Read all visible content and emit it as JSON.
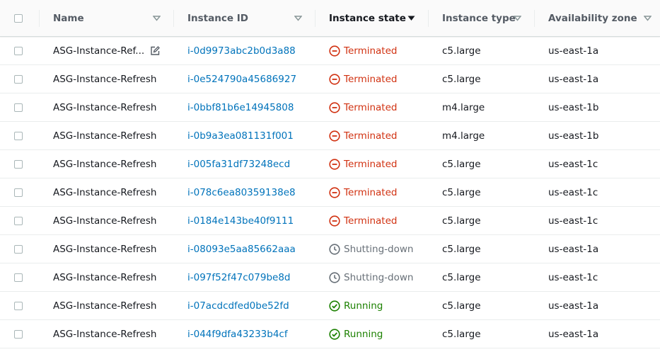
{
  "columns": {
    "name": "Name",
    "instance_id": "Instance ID",
    "instance_state": "Instance state",
    "instance_type": "Instance type",
    "availability_zone": "Availability zone"
  },
  "rows": [
    {
      "name": "ASG-Instance-Ref...",
      "id": "i-0d9973abc2b0d3a88",
      "state": "Terminated",
      "type": "c5.large",
      "zone": "us-east-1a"
    },
    {
      "name": "ASG-Instance-Refresh",
      "id": "i-0e524790a45686927",
      "state": "Terminated",
      "type": "c5.large",
      "zone": "us-east-1a"
    },
    {
      "name": "ASG-Instance-Refresh",
      "id": "i-0bbf81b6e14945808",
      "state": "Terminated",
      "type": "m4.large",
      "zone": "us-east-1b"
    },
    {
      "name": "ASG-Instance-Refresh",
      "id": "i-0b9a3ea081131f001",
      "state": "Terminated",
      "type": "m4.large",
      "zone": "us-east-1b"
    },
    {
      "name": "ASG-Instance-Refresh",
      "id": "i-005fa31df73248ecd",
      "state": "Terminated",
      "type": "c5.large",
      "zone": "us-east-1c"
    },
    {
      "name": "ASG-Instance-Refresh",
      "id": "i-078c6ea80359138e8",
      "state": "Terminated",
      "type": "c5.large",
      "zone": "us-east-1c"
    },
    {
      "name": "ASG-Instance-Refresh",
      "id": "i-0184e143be40f9111",
      "state": "Terminated",
      "type": "c5.large",
      "zone": "us-east-1c"
    },
    {
      "name": "ASG-Instance-Refresh",
      "id": "i-08093e5aa85662aaa",
      "state": "Shutting-down",
      "type": "c5.large",
      "zone": "us-east-1a"
    },
    {
      "name": "ASG-Instance-Refresh",
      "id": "i-097f52f47c079be8d",
      "state": "Shutting-down",
      "type": "c5.large",
      "zone": "us-east-1c"
    },
    {
      "name": "ASG-Instance-Refresh",
      "id": "i-07acdcdfed0be52fd",
      "state": "Running",
      "type": "c5.large",
      "zone": "us-east-1a"
    },
    {
      "name": "ASG-Instance-Refresh",
      "id": "i-044f9dfa43233b4cf",
      "state": "Running",
      "type": "c5.large",
      "zone": "us-east-1a"
    }
  ],
  "colors": {
    "link": "#0073bb",
    "terminated": "#d13212",
    "shutting_down": "#687078",
    "running": "#1d8102"
  },
  "icons": {
    "terminated": "minus-circle-icon",
    "shutting_down": "clock-icon",
    "running": "check-circle-icon",
    "edit": "edit-icon",
    "sort": "caret-down-icon"
  }
}
